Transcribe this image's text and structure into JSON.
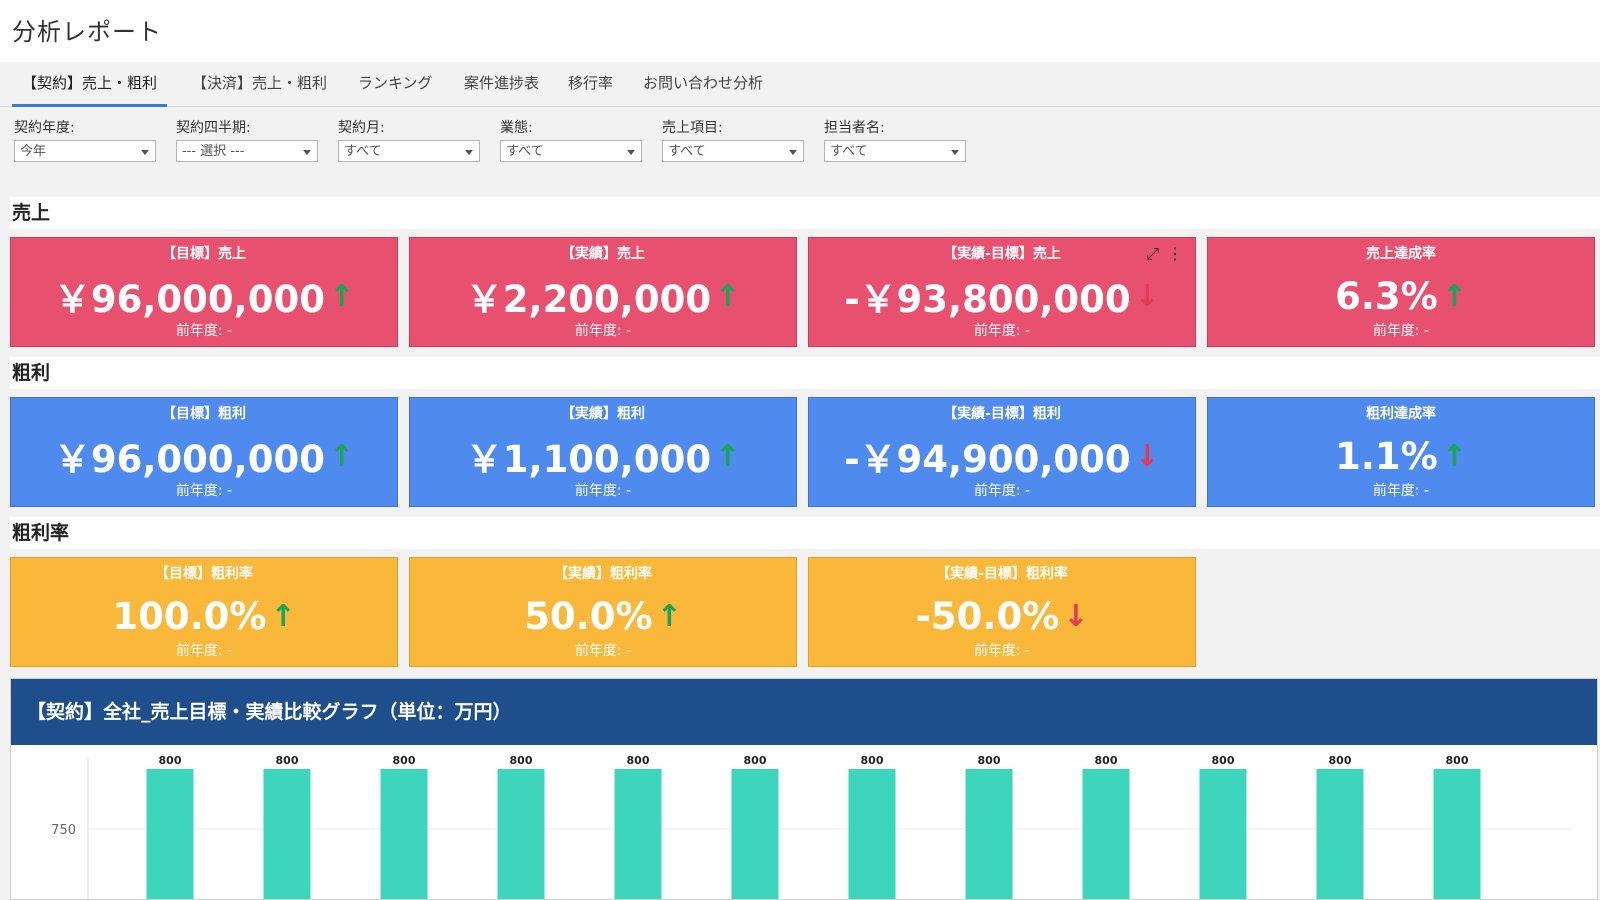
{
  "page": {
    "title": "分析レポート"
  },
  "tabs": [
    {
      "label": "【契約】売上・粗利",
      "active": true
    },
    {
      "label": "【決済】売上・粗利",
      "active": false
    },
    {
      "label": "ランキング",
      "active": false
    },
    {
      "label": "案件進捗表",
      "active": false
    },
    {
      "label": "移行率",
      "active": false
    },
    {
      "label": "お問い合わせ分析",
      "active": false
    }
  ],
  "filters": [
    {
      "label": "契約年度:",
      "value": "今年"
    },
    {
      "label": "契約四半期:",
      "value": "--- 選択 ---"
    },
    {
      "label": "契約月:",
      "value": "すべて"
    },
    {
      "label": "業態:",
      "value": "すべて"
    },
    {
      "label": "売上項目:",
      "value": "すべて"
    },
    {
      "label": "担当者名:",
      "value": "すべて"
    }
  ],
  "sections": {
    "sales": {
      "title": "売上",
      "cards": [
        {
          "title": "【目標】売上",
          "value": "￥96,000,000",
          "trend": "up",
          "arrow": "↑",
          "sub": "前年度: -"
        },
        {
          "title": "【実績】売上",
          "value": "￥2,200,000",
          "trend": "up",
          "arrow": "↑",
          "sub": "前年度: -"
        },
        {
          "title": "【実績-目標】売上",
          "value": "-￥93,800,000",
          "trend": "down",
          "arrow": "↓",
          "sub": "前年度: -"
        },
        {
          "title": "売上達成率",
          "value": "6.3%",
          "trend": "up",
          "arrow": "↑",
          "sub": "前年度: -"
        }
      ]
    },
    "gross": {
      "title": "粗利",
      "cards": [
        {
          "title": "【目標】粗利",
          "value": "￥96,000,000",
          "trend": "up",
          "arrow": "↑",
          "sub": "前年度: -"
        },
        {
          "title": "【実績】粗利",
          "value": "￥1,100,000",
          "trend": "up",
          "arrow": "↑",
          "sub": "前年度: -"
        },
        {
          "title": "【実績-目標】粗利",
          "value": "-￥94,900,000",
          "trend": "down",
          "arrow": "↓",
          "sub": "前年度: -"
        },
        {
          "title": "粗利達成率",
          "value": "1.1%",
          "trend": "up",
          "arrow": "↑",
          "sub": "前年度: -"
        }
      ]
    },
    "margin": {
      "title": "粗利率",
      "cards": [
        {
          "title": "【目標】粗利率",
          "value": "100.0%",
          "trend": "up",
          "arrow": "↑",
          "sub": "前年度: -"
        },
        {
          "title": "【実績】粗利率",
          "value": "50.0%",
          "trend": "up",
          "arrow": "↑",
          "sub": "前年度: -"
        },
        {
          "title": "【実績-目標】粗利率",
          "value": "-50.0%",
          "trend": "down",
          "arrow": "↓",
          "sub": "前年度: -"
        }
      ]
    }
  },
  "card_tools": {
    "expand": "⤢",
    "more": "⋮"
  },
  "colors": {
    "sales_card": "#e8506f",
    "gross_card": "#4f8bee",
    "margin_card": "#f9b83a",
    "chart_header": "#1e4f8c",
    "bar": "#3dd6bd",
    "trend_up": "#1aa35a",
    "trend_down": "#e53956"
  },
  "chart_panel": {
    "title": "【契約】全社_売上目標・実績比較グラフ（単位：万円）"
  },
  "chart_data": {
    "type": "bar",
    "title": "【契約】全社_売上目標・実績比較グラフ（単位：万円）",
    "categories": [
      "",
      "",
      "",
      "",
      "",
      "",
      "",
      "",
      "",
      "",
      "",
      ""
    ],
    "series": [
      {
        "values": [
          800,
          800,
          800,
          800,
          800,
          800,
          800,
          800,
          800,
          800,
          800,
          800
        ]
      }
    ],
    "yticks": [
      750
    ],
    "ylim": [
      690,
      820
    ],
    "grid": true
  }
}
